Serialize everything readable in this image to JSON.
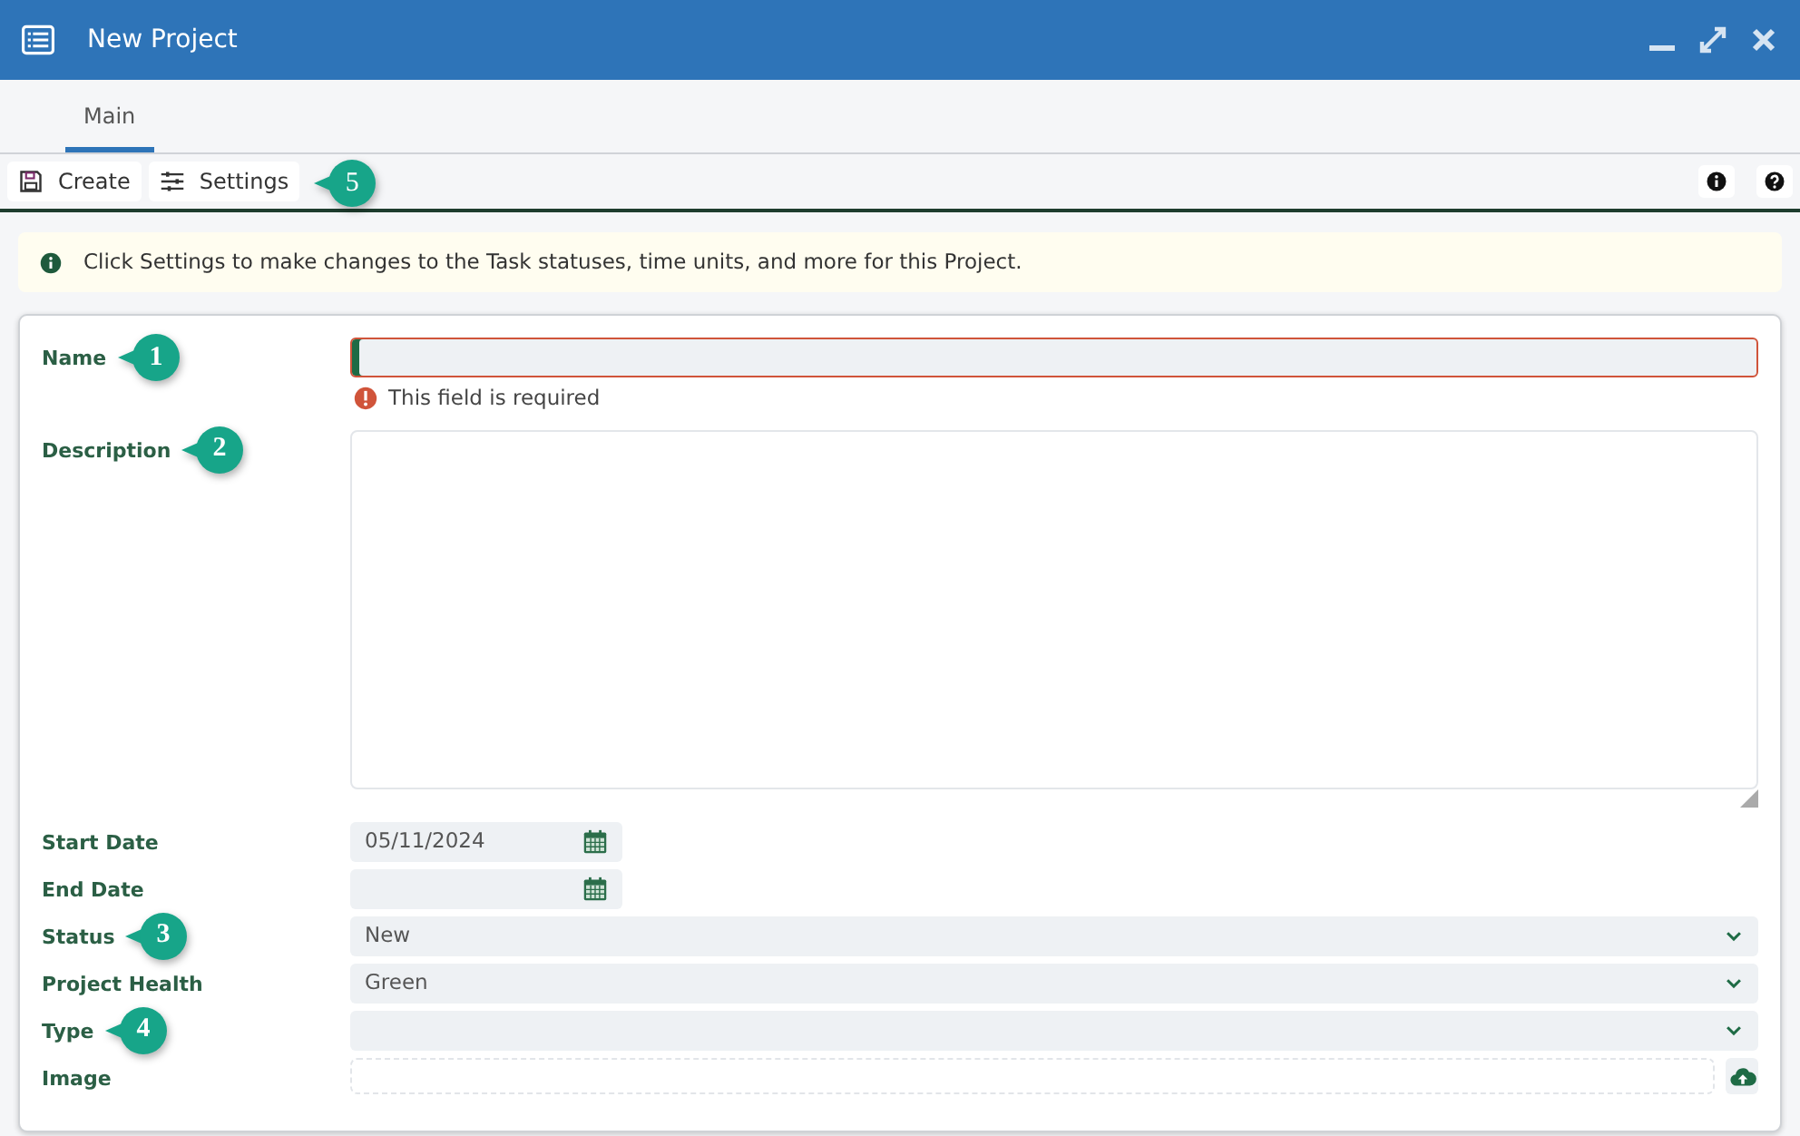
{
  "window": {
    "title": "New Project"
  },
  "tabs": [
    {
      "label": "Main",
      "selected": true
    }
  ],
  "toolbar": {
    "buttons": [
      {
        "kind": "save",
        "label": "Create"
      },
      {
        "kind": "sliders",
        "label": "Settings",
        "callout": "5"
      }
    ],
    "right_icons": [
      {
        "kind": "info"
      },
      {
        "kind": "help"
      }
    ]
  },
  "banner": {
    "text": "Click Settings to make changes to the Task statuses, time units, and more for this Project."
  },
  "fields": [
    {
      "kind": "text",
      "label": "Name",
      "focused": true,
      "error": "This field is required",
      "callout": "1"
    },
    {
      "kind": "textarea",
      "label": "Description",
      "callout": "2"
    },
    {
      "kind": "date",
      "label": "Start Date",
      "value": "05/11/2024"
    },
    {
      "kind": "date",
      "label": "End Date"
    },
    {
      "kind": "select",
      "label": "Status",
      "value": "New",
      "callout": "3"
    },
    {
      "kind": "select",
      "label": "Project Health",
      "value": "Green"
    },
    {
      "kind": "select",
      "label": "Type",
      "callout": "4"
    },
    {
      "kind": "file",
      "label": "Image"
    }
  ]
}
